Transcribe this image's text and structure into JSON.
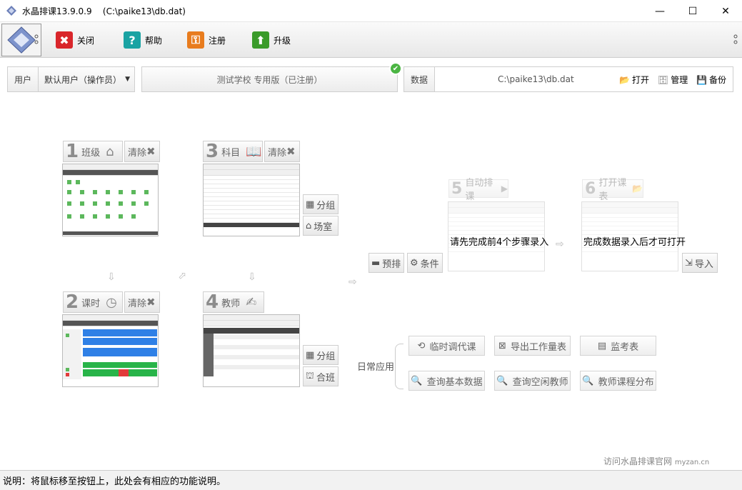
{
  "window": {
    "title": "水晶排课13.9.0.9",
    "path": "(C:\\paike13\\db.dat)"
  },
  "toolbar": {
    "close": "关闭",
    "help": "帮助",
    "register": "注册",
    "upgrade": "升级"
  },
  "header": {
    "user_label": "用户",
    "user_value": "默认用户（操作员）",
    "school": "测试学校 专用版（已注册）",
    "data_label": "数据",
    "data_path": "C:\\paike13\\db.dat",
    "open": "打开",
    "manage": "管理",
    "backup": "备份"
  },
  "steps": [
    {
      "num": "1",
      "title": "班级",
      "clear": "清除"
    },
    {
      "num": "2",
      "title": "课时",
      "clear": "清除"
    },
    {
      "num": "3",
      "title": "科目",
      "clear": "清除"
    },
    {
      "num": "4",
      "title": "教师"
    },
    {
      "num": "5",
      "title": "自动排课",
      "note": "请先完成前4个步骤录入"
    },
    {
      "num": "6",
      "title": "打开课表",
      "note": "完成数据录入后才可打开"
    }
  ],
  "side_buttons": {
    "group1": "分组",
    "room": "场室",
    "group2": "分组",
    "merge": "合班",
    "prearrange": "预排",
    "condition": "条件",
    "import": "导入"
  },
  "daily": {
    "label": "日常应用",
    "buttons": [
      "临时调代课",
      "导出工作量表",
      "监考表",
      "查询基本数据",
      "查询空闲教师",
      "教师课程分布"
    ]
  },
  "site": {
    "text": "访问水晶排课官网",
    "domain": "myzan.cn"
  },
  "status": "说明：将鼠标移至按钮上，此处会有相应的功能说明。",
  "colors": {
    "close": "#d9262b",
    "help": "#1aa3a3",
    "register": "#e87c1e",
    "upgrade": "#3a9b2a",
    "check": "#4bb543"
  }
}
